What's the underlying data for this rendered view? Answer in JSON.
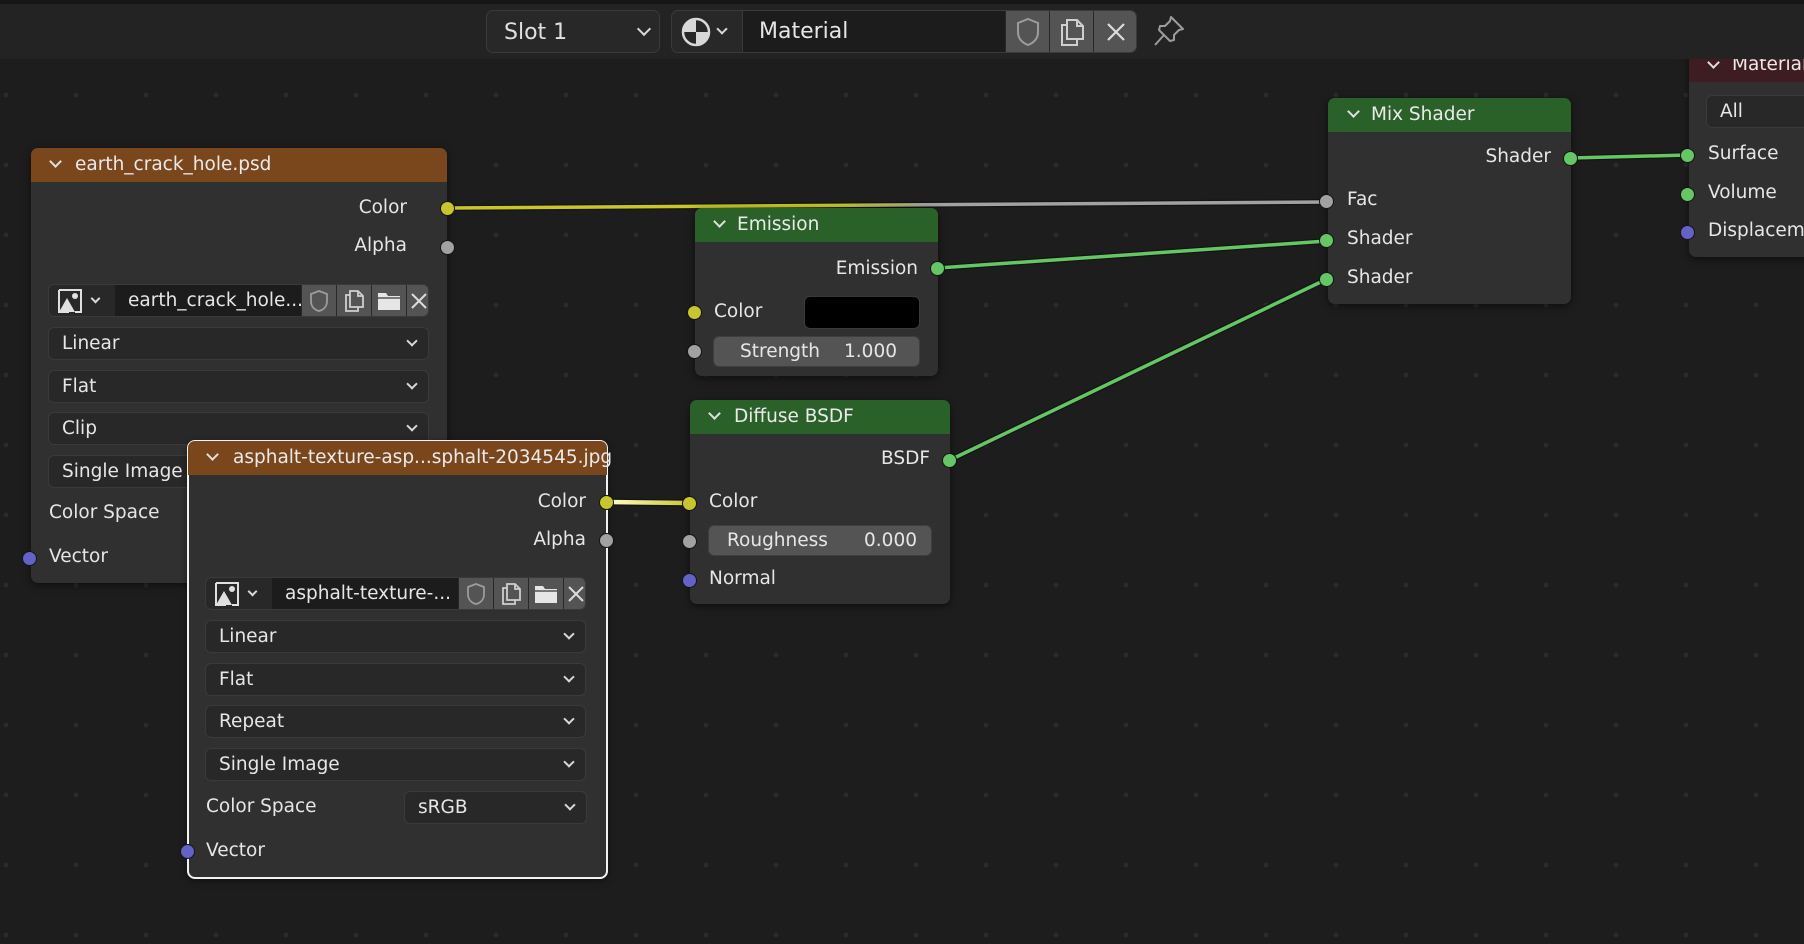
{
  "header": {
    "slot_label": "Slot 1",
    "material_name": "Material",
    "icons": [
      "material-sphere-icon",
      "shield-icon",
      "duplicate-icon",
      "close-icon",
      "pin-icon"
    ]
  },
  "nodes": {
    "earth": {
      "title": "earth_crack_hole.psd",
      "outputs": [
        "Color",
        "Alpha"
      ],
      "image_name": "earth_crack_hole...",
      "interpolation": "Linear",
      "projection": "Flat",
      "extension": "Clip",
      "source": "Single Image",
      "color_space_label": "Color Space",
      "inputs": [
        "Vector"
      ]
    },
    "asphalt": {
      "title": "asphalt-texture-asp...sphalt-2034545.jpg",
      "outputs": [
        "Color",
        "Alpha"
      ],
      "image_name": "asphalt-texture-...",
      "interpolation": "Linear",
      "projection": "Flat",
      "extension": "Repeat",
      "source": "Single Image",
      "color_space_label": "Color Space",
      "color_space_value": "sRGB",
      "inputs": [
        "Vector"
      ]
    },
    "emission": {
      "title": "Emission",
      "output": "Emission",
      "color_label": "Color",
      "color_value": "#000000",
      "strength_label": "Strength",
      "strength_value": "1.000"
    },
    "diffuse": {
      "title": "Diffuse BSDF",
      "output": "BSDF",
      "color_label": "Color",
      "roughness_label": "Roughness",
      "roughness_value": "0.000",
      "normal_label": "Normal"
    },
    "mix": {
      "title": "Mix Shader",
      "output": "Shader",
      "fac_label": "Fac",
      "shader1_label": "Shader",
      "shader2_label": "Shader"
    },
    "output": {
      "title": "Material",
      "target": "All",
      "surface_label": "Surface",
      "volume_label": "Volume",
      "displacement_label": "Displacem"
    }
  },
  "colors": {
    "image_header": "#7a461c",
    "shader_header": "#2a6129",
    "output_header": "#3d1c22",
    "socket_color": "#c7c729",
    "socket_float": "#a1a1a1",
    "socket_shader": "#63c763",
    "socket_vector": "#6363c7"
  }
}
